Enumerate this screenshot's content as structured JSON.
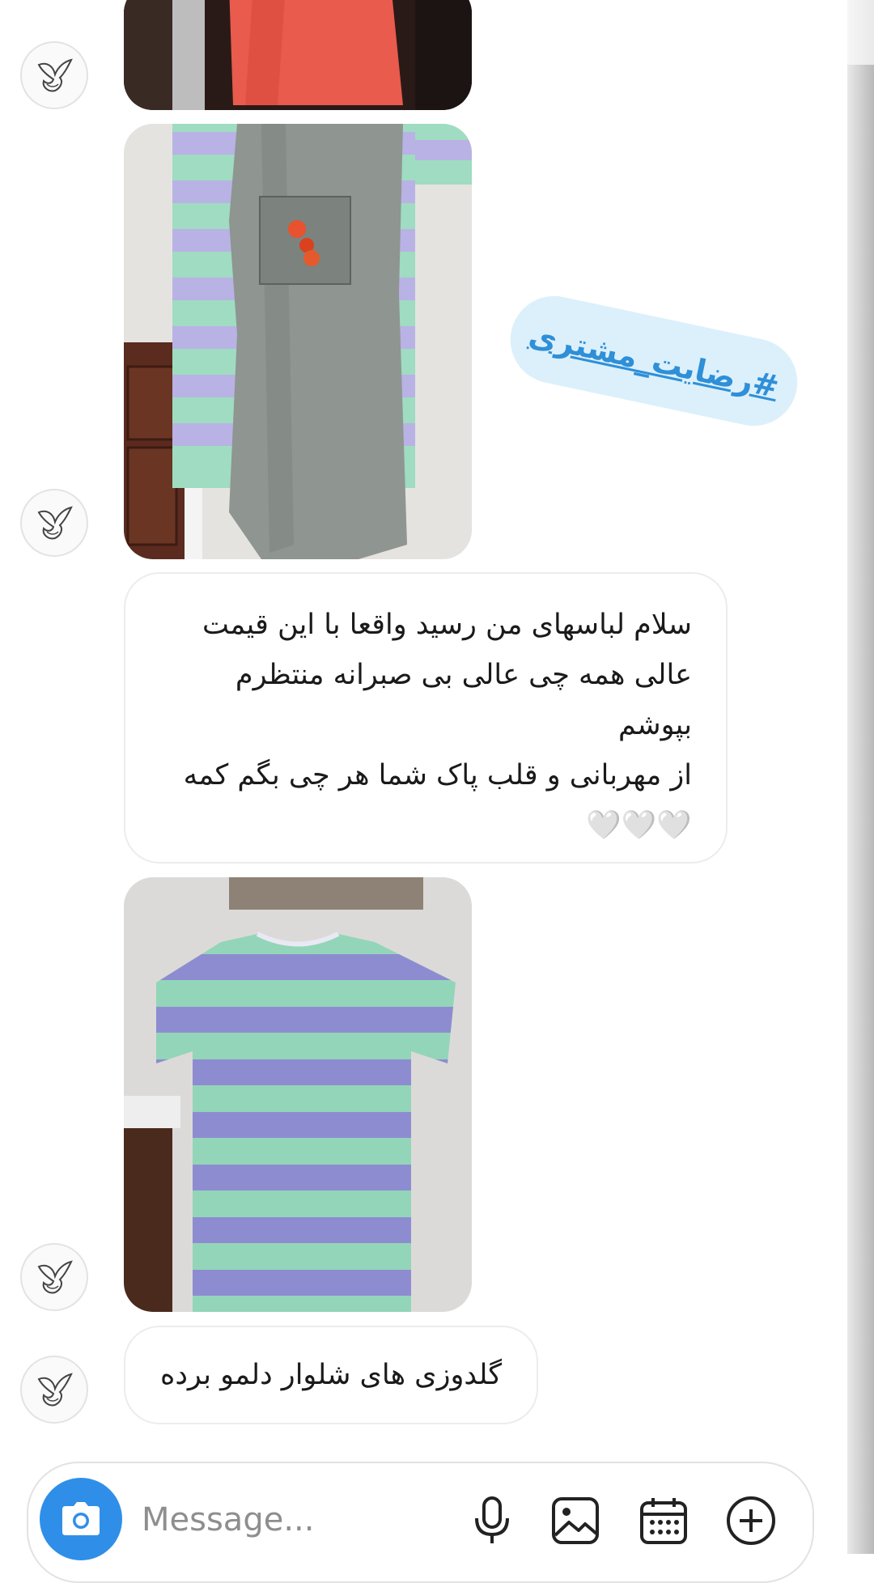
{
  "messages": {
    "hashtag": "#رضایت_مشتری",
    "text1": "سلام لباسهای من رسید واقعا با این قیمت\nعالی همه چی عالی بی صبرانه منتظرم\nبپوشم\nاز مهربانی  و قلب پاک شما هر چی بگم کمه\n🤍🤍🤍",
    "text2": "گلدوزی های شلوار دلمو برده"
  },
  "photos": [
    {
      "name": "red garment photo"
    },
    {
      "name": "grey pants with embroidered pocket photo"
    },
    {
      "name": "striped t-shirt photo"
    }
  ],
  "composer": {
    "placeholder": "Message...",
    "icons": [
      "camera-icon",
      "microphone-icon",
      "image-icon",
      "calendar-icon",
      "add-icon"
    ]
  },
  "colors": {
    "accent": "#2f8fe8",
    "hashtag_text": "#2f8fd8",
    "hashtag_bg": "#dcf0fb"
  }
}
